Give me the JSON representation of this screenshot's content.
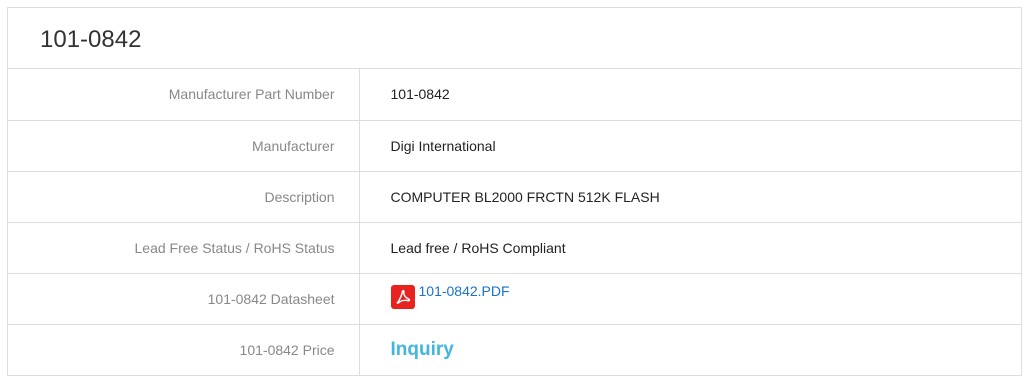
{
  "panel": {
    "title": "101-0842"
  },
  "specs": [
    {
      "label": "Manufacturer Part Number",
      "value": "101-0842"
    },
    {
      "label": "Manufacturer",
      "value": "Digi International"
    },
    {
      "label": "Description",
      "value": "COMPUTER BL2000 FRCTN 512K FLASH"
    },
    {
      "label": "Lead Free Status / RoHS Status",
      "value": "Lead free / RoHS Compliant"
    },
    {
      "label": "101-0842 Datasheet",
      "value": "101-0842.PDF",
      "icon": "pdf-icon"
    },
    {
      "label": "101-0842 Price",
      "value": "Inquiry"
    }
  ],
  "colors": {
    "pdf_icon": "#e8231f",
    "link": "#1a73c8",
    "inquiry": "#43b6e0",
    "border": "#dddddd"
  }
}
